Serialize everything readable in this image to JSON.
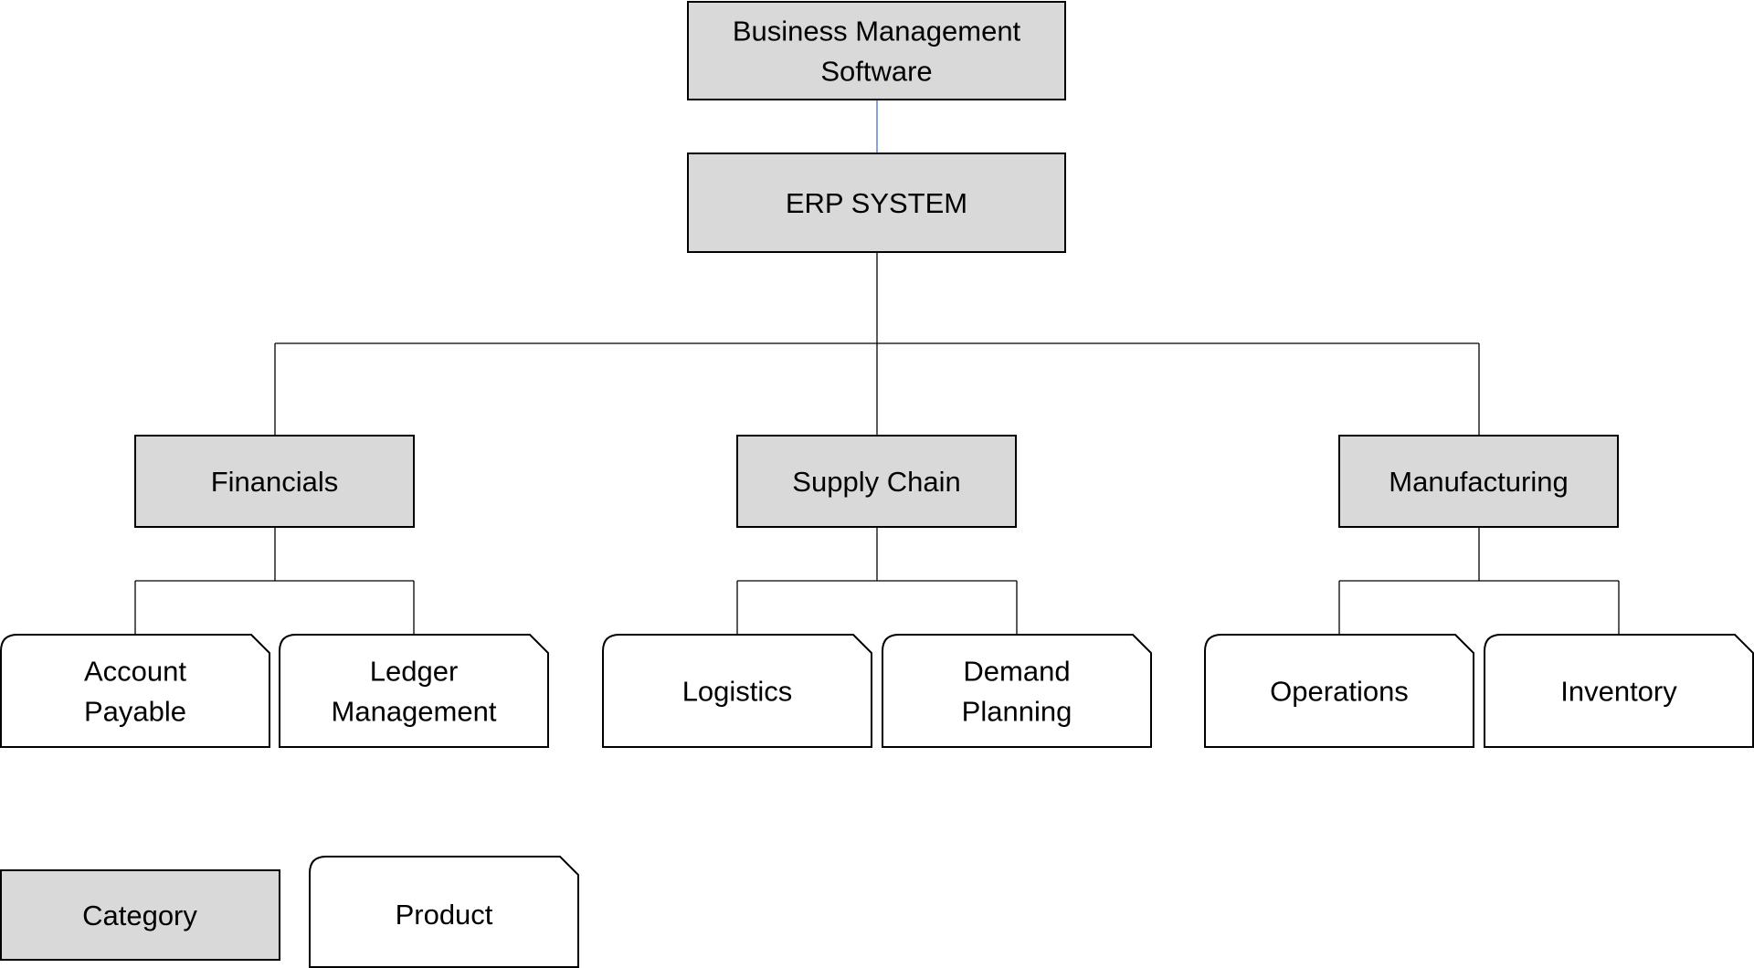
{
  "root": {
    "lines": [
      "Business Management",
      "Software"
    ]
  },
  "erp": {
    "lines": [
      "ERP SYSTEM"
    ]
  },
  "categories": [
    {
      "lines": [
        "Financials"
      ],
      "products": [
        {
          "lines": [
            "Account",
            "Payable"
          ]
        },
        {
          "lines": [
            "Ledger",
            "Management"
          ]
        }
      ]
    },
    {
      "lines": [
        "Supply Chain"
      ],
      "products": [
        {
          "lines": [
            "Logistics"
          ]
        },
        {
          "lines": [
            "Demand",
            "Planning"
          ]
        }
      ]
    },
    {
      "lines": [
        "Manufacturing"
      ],
      "products": [
        {
          "lines": [
            "Operations"
          ]
        },
        {
          "lines": [
            "Inventory"
          ]
        }
      ]
    }
  ],
  "legend": {
    "category": "Category",
    "product": "Product"
  },
  "colors": {
    "category_fill": "#d9d9d9",
    "product_fill": "#ffffff",
    "root_connector": "#4472c4"
  }
}
